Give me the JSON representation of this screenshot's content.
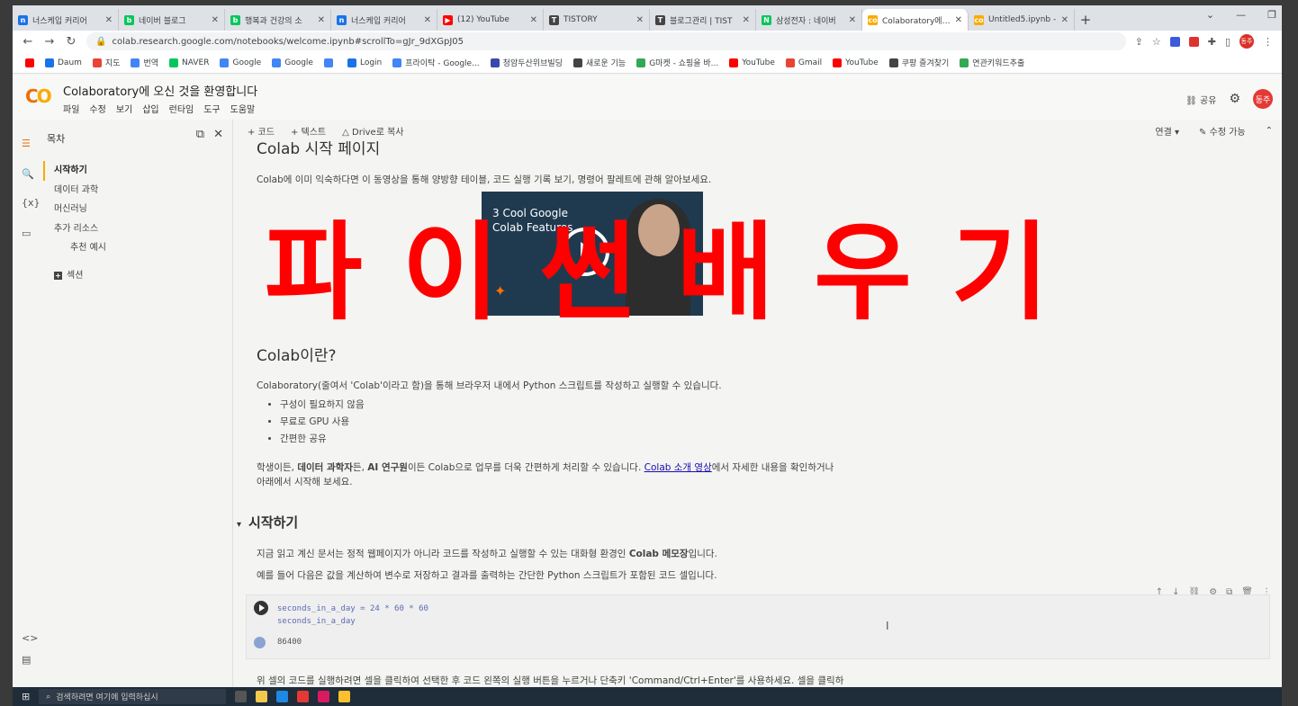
{
  "browser": {
    "tabs": [
      {
        "title": "너스케입 커리어",
        "icon_color": "#1a73e8",
        "icon": "n"
      },
      {
        "title": "네이버 블로그",
        "icon_color": "#03c75a",
        "icon": "b"
      },
      {
        "title": "행복과 건강의 소",
        "icon_color": "#03c75a",
        "icon": "b"
      },
      {
        "title": "너스케입 커리어",
        "icon_color": "#1a73e8",
        "icon": "n"
      },
      {
        "title": "(12) YouTube",
        "icon_color": "#ff0000",
        "icon": "▶"
      },
      {
        "title": "TISTORY",
        "icon_color": "#444444",
        "icon": "T"
      },
      {
        "title": "블로그관리 | TIST",
        "icon_color": "#444444",
        "icon": "T"
      },
      {
        "title": "삼성전자 : 네이버",
        "icon_color": "#03c75a",
        "icon": "N"
      },
      {
        "title": "Colaboratory에 오",
        "icon_color": "#f9ab00",
        "icon": "co",
        "active": true
      },
      {
        "title": "Untitled5.ipynb -",
        "icon_color": "#f9ab00",
        "icon": "co"
      }
    ],
    "new_tab": "+",
    "url": "colab.research.google.com/notebooks/welcome.ipynb#scrollTo=gJr_9dXGpJ05",
    "bookmarks": [
      {
        "label": "Daum",
        "color": "#1a73e8"
      },
      {
        "label": "지도",
        "color": "#ea4335"
      },
      {
        "label": "번역",
        "color": "#4285f4"
      },
      {
        "label": "NAVER",
        "color": "#03c75a"
      },
      {
        "label": "Google",
        "color": "#4285f4"
      },
      {
        "label": "Google",
        "color": "#4285f4"
      },
      {
        "label": "",
        "color": "#4285f4"
      },
      {
        "label": "Login",
        "color": "#1a73e8"
      },
      {
        "label": "프라이탁 - Google...",
        "color": "#4285f4"
      },
      {
        "label": "청암두산위브빌딩",
        "color": "#3949ab"
      },
      {
        "label": "새로운 기능",
        "color": "#444444"
      },
      {
        "label": "G마켓 - 쇼핑을 바...",
        "color": "#34a853"
      },
      {
        "label": "YouTube",
        "color": "#ff0000"
      },
      {
        "label": "Gmail",
        "color": "#ea4335"
      },
      {
        "label": "YouTube",
        "color": "#ff0000"
      },
      {
        "label": "쿠팡 즐겨찾기",
        "color": "#444444"
      },
      {
        "label": "연관키워드추출",
        "color": "#34a853"
      }
    ],
    "profile_initials": "동주"
  },
  "colab": {
    "logo": "CO",
    "title": "Colaboratory에 오신 것을 환영합니다",
    "menu": [
      "파일",
      "수정",
      "보기",
      "삽입",
      "런타임",
      "도구",
      "도움말"
    ],
    "share_label": "공유",
    "avatar": "동주",
    "toolbar": {
      "add_code": "+ 코드",
      "add_text": "+ 텍스트",
      "copy_drive": "Drive로 복사",
      "connect": "연결",
      "editable": "수정 가능"
    },
    "sidebar": {
      "header": "목차",
      "items": [
        {
          "label": "시작하기",
          "active": true
        },
        {
          "label": "데이터 과학"
        },
        {
          "label": "머신러닝"
        },
        {
          "label": "추가 리소스"
        },
        {
          "label": "추천 예시",
          "sub": true
        }
      ],
      "add_section": "섹션"
    },
    "content": {
      "h1_partial": "Colab 시작 페이지",
      "intro": "Colab에 이미 익숙하다면 이 동영상을 통해 양방향 테이블, 코드 실행 기록 보기, 명령어 팔레트에 관해 알아보세요.",
      "video_title_line1": "3 Cool Google",
      "video_title_line2": "Colab Features",
      "h2": "Colab이란?",
      "p1": "Colaboratory(줄여서 'Colab'이라고 함)을 통해 브라우저 내에서 Python 스크립트를 작성하고 실행할 수 있습니다.",
      "bullets": [
        "구성이 필요하지 않음",
        "무료로 GPU 사용",
        "간편한 공유"
      ],
      "p2_a": "학생이든, ",
      "p2_b": "데이터 과학자",
      "p2_c": "든, ",
      "p2_d": "AI 연구원",
      "p2_e": "이든 Colab으로 업무를 더욱 간편하게 처리할 수 있습니다. ",
      "p2_link": "Colab 소개 영상",
      "p2_f": "에서 자세한 내용을 확인하거나",
      "p2_line2": "아래에서 시작해 보세요.",
      "section": "시작하기",
      "p3_a": "지금 읽고 계신 문서는 정적 웹페이지가 아니라 코드를 작성하고 실행할 수 있는 대화형 환경인 ",
      "p3_b": "Colab 메모장",
      "p3_c": "입니다.",
      "p4": "예를 들어 다음은 값을 계산하여 변수로 저장하고 결과를 출력하는 간단한 Python 스크립트가 포함된 코드 셀입니다.",
      "code_line1": "seconds_in_a_day = 24 * 60 * 60",
      "code_line2": "seconds_in_a_day",
      "output": "86400",
      "p5": "위 셀의 코드를 실행하려면 셀을 클릭하여 선택한 후 코드 왼쪽의 실행 버튼을 누르거나 단축키 'Command/Ctrl+Enter'를 사용하세요. 셀을 클릭하"
    }
  },
  "overlay_text": "파이썬배우기",
  "taskbar": {
    "search_placeholder": "검색하려면 여기에 입력하십시"
  }
}
